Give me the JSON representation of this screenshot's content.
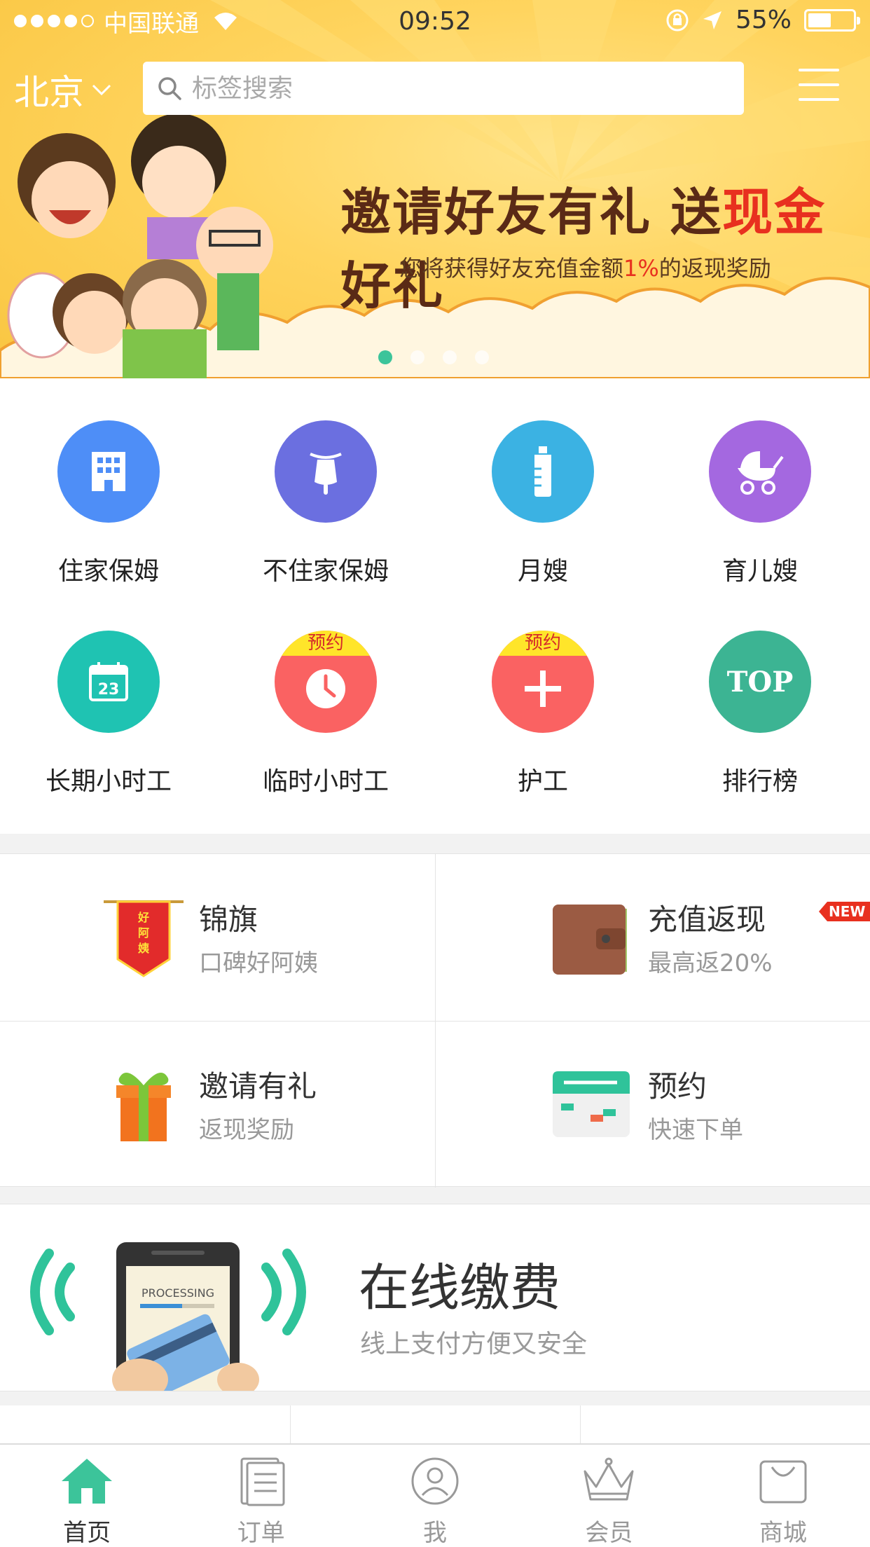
{
  "status": {
    "carrier": "中国联通",
    "time": "09:52",
    "battery": "55%"
  },
  "header": {
    "city": "北京",
    "search_placeholder": "标签搜索"
  },
  "banner": {
    "title_part1": "邀请好友有礼 送",
    "title_highlight": "现金",
    "title_part2": "好礼",
    "sub_part1": "您将获得好友充值金额",
    "sub_highlight": "1%",
    "sub_part2": "的返现奖励",
    "page_count": 4,
    "active_page": 1
  },
  "categories": [
    {
      "label": "住家保姆",
      "color": "#4e8ef7",
      "icon": "building-icon"
    },
    {
      "label": "不住家保姆",
      "color": "#6b6fe0",
      "icon": "scooter-icon"
    },
    {
      "label": "月嫂",
      "color": "#3bb2e3",
      "icon": "baby-bottle-icon"
    },
    {
      "label": "育儿嫂",
      "color": "#a468e0",
      "icon": "stroller-icon"
    },
    {
      "label": "长期小时工",
      "color": "#1fc3b2",
      "icon": "calendar-icon",
      "calendar_day": "23"
    },
    {
      "label": "临时小时工",
      "color": "#fa6262",
      "icon": "clock-icon",
      "badge": "预约"
    },
    {
      "label": "护工",
      "color": "#fa6262",
      "icon": "plus-icon",
      "badge": "预约"
    },
    {
      "label": "排行榜",
      "color": "#3cb493",
      "icon": "top-icon",
      "icon_text": "TOP"
    }
  ],
  "features": [
    {
      "title": "锦旗",
      "sub": "口碑好阿姨",
      "icon": "pennant-icon",
      "pennant_text": [
        "好",
        "阿",
        "姨"
      ]
    },
    {
      "title": "充值返现",
      "sub": "最高返20%",
      "icon": "wallet-icon",
      "badge": "NEW"
    },
    {
      "title": "邀请有礼",
      "sub": "返现奖励",
      "icon": "gift-icon"
    },
    {
      "title": "预约",
      "sub": "快速下单",
      "icon": "schedule-icon"
    }
  ],
  "pay": {
    "title": "在线缴费",
    "sub": "线上支付方便又安全",
    "screen_text": "PROCESSING"
  },
  "tabs": [
    {
      "label": "首页",
      "icon": "home-icon",
      "active": true
    },
    {
      "label": "订单",
      "icon": "orders-icon",
      "active": false
    },
    {
      "label": "我",
      "icon": "profile-icon",
      "active": false
    },
    {
      "label": "会员",
      "icon": "crown-icon",
      "active": false
    },
    {
      "label": "商城",
      "icon": "shopping-bag-icon",
      "active": false
    }
  ],
  "colors": {
    "accent": "#3cc49a",
    "banner_yellow": "#ffd45e",
    "promo_red": "#e8301f"
  }
}
